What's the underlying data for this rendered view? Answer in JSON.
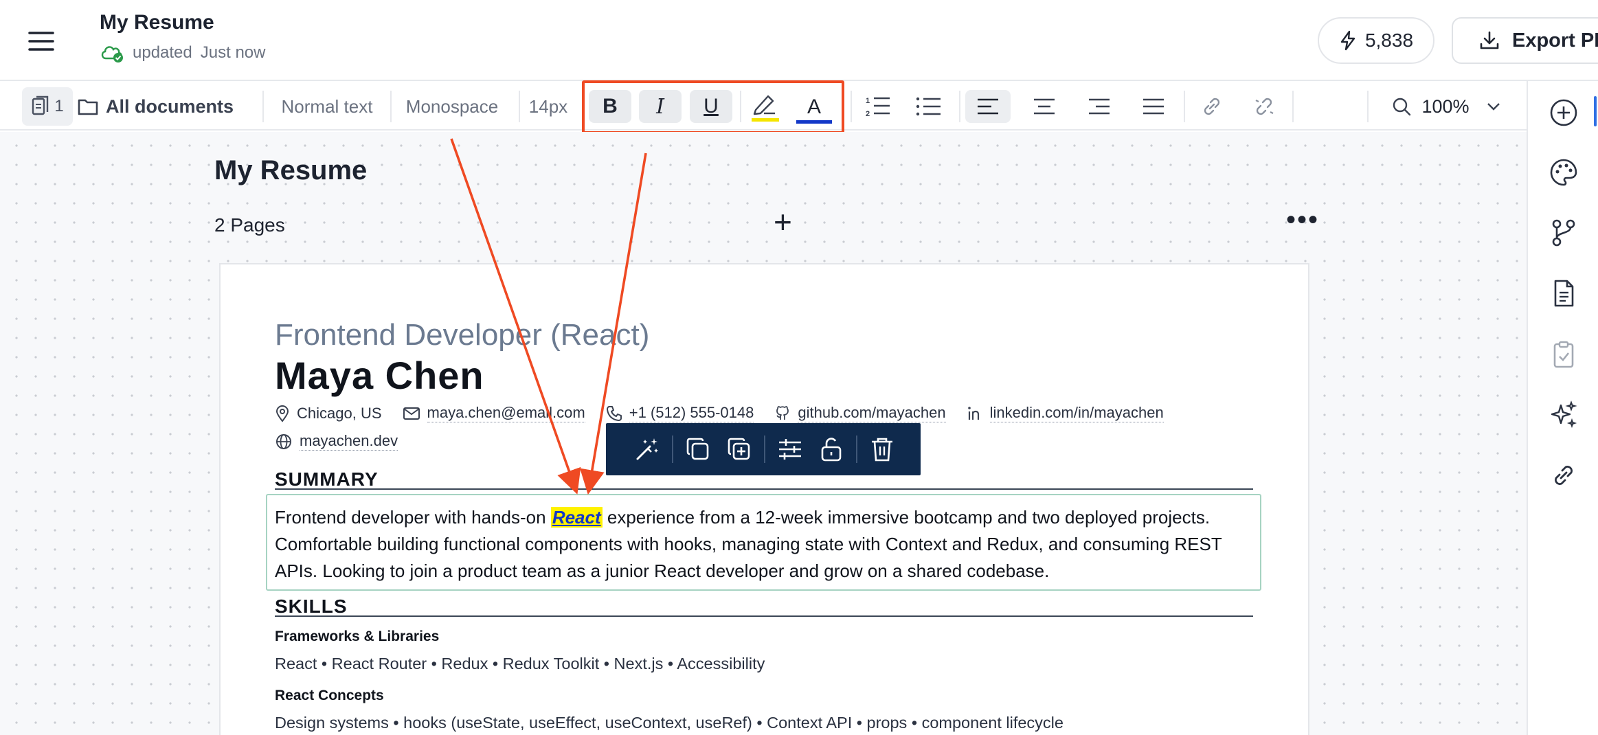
{
  "header": {
    "title": "My Resume",
    "save_prefix": "updated",
    "save_status": "Just now",
    "credits": "5,838",
    "export_label": "Export PDF"
  },
  "toolbar": {
    "page_count": "1",
    "all_documents": "All documents",
    "style": "Normal text",
    "font": "Monospace",
    "font_size": "14px",
    "bold": "B",
    "italic": "I",
    "underline": "U",
    "text_color": "A",
    "zoom": "100%",
    "highlight_color": "#f5e500",
    "text_color_swatch": "#1338c8"
  },
  "canvas": {
    "title": "My Resume",
    "pages": "2 Pages"
  },
  "resume": {
    "role": "Frontend Developer (React)",
    "name": "Maya Chen",
    "contacts": [
      {
        "icon": "location-icon",
        "text": "Chicago, US"
      },
      {
        "icon": "mail-icon",
        "text": "maya.chen@email.com"
      },
      {
        "icon": "phone-icon",
        "text": "+1 (512) 555-0148"
      },
      {
        "icon": "github-icon",
        "text": "github.com/mayachen"
      },
      {
        "icon": "linkedin-icon",
        "text": "linkedin.com/in/mayachen"
      },
      {
        "icon": "globe-icon",
        "text": "mayachen.dev"
      }
    ],
    "summary_heading": "SUMMARY",
    "summary_before": "Frontend developer with hands-on ",
    "summary_keyword": "React",
    "summary_after": " experience from a 12-week immersive bootcamp and two deployed projects. Comfortable building functional components with hooks, managing state with Context and Redux, and consuming REST APIs. Looking to join a product team as a junior React developer and grow on a shared codebase.",
    "skills_heading": "SKILLS",
    "skill_groups": [
      {
        "title": "Frameworks & Libraries",
        "items": "React • React Router • Redux • Redux Toolkit • Next.js • Accessibility"
      },
      {
        "title": "React Concepts",
        "items": "Design systems • hooks (useState, useEffect, useContext, useRef) • Context API • props • component lifecycle"
      }
    ]
  },
  "floating_toolbar": [
    "magic-wand-icon",
    "copy-icon",
    "duplicate-icon",
    "settings-sliders-icon",
    "unlock-icon",
    "trash-icon"
  ],
  "rail": [
    "add-icon",
    "palette-icon",
    "branch-icon",
    "document-icon",
    "clipboard-check-icon",
    "sparkles-icon",
    "link-icon"
  ],
  "colors": {
    "annotation": "#ef4a23",
    "floating_bar": "#0f2a4d",
    "accent": "#2f6fe4"
  }
}
